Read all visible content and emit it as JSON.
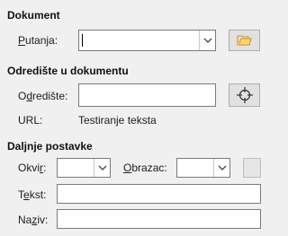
{
  "sections": {
    "document": "Dokument",
    "target_in_document": "Odredište u dokumentu",
    "further_settings": "Daljnje postavke"
  },
  "document": {
    "path_label_first": "P",
    "path_label_rest": "utanja:",
    "path_value": "",
    "open_icon": "folder-open-icon"
  },
  "target": {
    "target_label_pre": "O",
    "target_label_ul": "d",
    "target_label_post": "redište:",
    "target_value": "",
    "url_label": "URL:",
    "url_value": "Testiranje teksta",
    "target_icon": "crosshair-icon"
  },
  "further": {
    "frame_label_pre": "Okvi",
    "frame_label_ul": "r",
    "frame_label_post": ":",
    "frame_value": "",
    "form_label_ul": "O",
    "form_label_post": "brazac:",
    "form_value": "",
    "text_label_pre": "T",
    "text_label_ul": "e",
    "text_label_post": "kst:",
    "text_value": "",
    "name_label_pre": "Na",
    "name_label_ul": "z",
    "name_label_post": "iv:",
    "name_value": ""
  }
}
